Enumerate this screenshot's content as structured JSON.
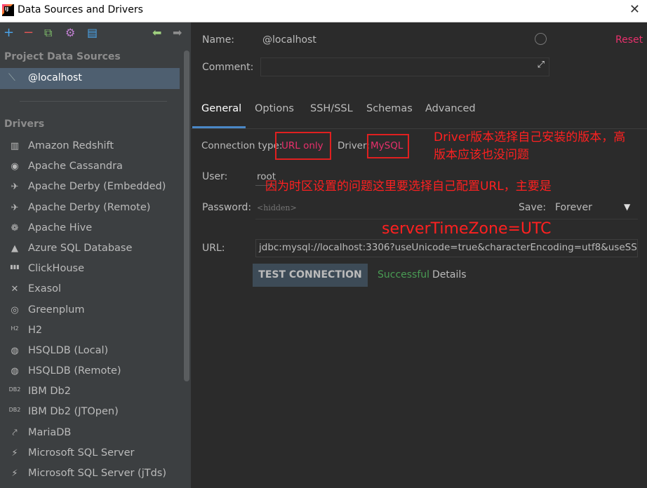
{
  "window": {
    "title": "Data Sources and Drivers"
  },
  "sidebar": {
    "project_label": "Project Data Sources",
    "selected_source": "@localhost",
    "drivers_label": "Drivers",
    "drivers": [
      {
        "label": "Amazon Redshift",
        "icon": "redshift-icon",
        "glyph": "▥"
      },
      {
        "label": "Apache Cassandra",
        "icon": "cassandra-icon",
        "glyph": "◉"
      },
      {
        "label": "Apache Derby (Embedded)",
        "icon": "derby-icon",
        "glyph": "✈"
      },
      {
        "label": "Apache Derby (Remote)",
        "icon": "derby-icon",
        "glyph": "✈"
      },
      {
        "label": "Apache Hive",
        "icon": "hive-icon",
        "glyph": "❁"
      },
      {
        "label": "Azure SQL Database",
        "icon": "azure-icon",
        "glyph": "▲"
      },
      {
        "label": "ClickHouse",
        "icon": "clickhouse-icon",
        "glyph": "▮▮▮"
      },
      {
        "label": "Exasol",
        "icon": "exasol-icon",
        "glyph": "✕"
      },
      {
        "label": "Greenplum",
        "icon": "greenplum-icon",
        "glyph": "◎"
      },
      {
        "label": "H2",
        "icon": "h2-icon",
        "glyph": "H2"
      },
      {
        "label": "HSQLDB (Local)",
        "icon": "hsqldb-icon",
        "glyph": "◍"
      },
      {
        "label": "HSQLDB (Remote)",
        "icon": "hsqldb-icon",
        "glyph": "◍"
      },
      {
        "label": "IBM Db2",
        "icon": "ibm-db2-icon",
        "glyph": "DB2"
      },
      {
        "label": "IBM Db2 (JTOpen)",
        "icon": "ibm-db2-icon",
        "glyph": "DB2"
      },
      {
        "label": "MariaDB",
        "icon": "mariadb-icon",
        "glyph": "⤤"
      },
      {
        "label": "Microsoft SQL Server",
        "icon": "mssql-icon",
        "glyph": "⚡"
      },
      {
        "label": "Microsoft SQL Server (jTds)",
        "icon": "mssql-icon",
        "glyph": "⚡"
      }
    ]
  },
  "form": {
    "name_label": "Name:",
    "name_value": "@localhost",
    "reset_label": "Reset",
    "comment_label": "Comment:",
    "tabs": [
      "General",
      "Options",
      "SSH/SSL",
      "Schemas",
      "Advanced"
    ],
    "connection_type_label": "Connection type:",
    "connection_type_value": "URL only",
    "driver_label": "Driver:",
    "driver_value": "MySQL",
    "user_label": "User:",
    "user_value": "root",
    "password_label": "Password:",
    "password_placeholder": "<hidden>",
    "save_label": "Save:",
    "save_value": "Forever",
    "url_label": "URL:",
    "url_value": "jdbc:mysql://localhost:3306?useUnicode=true&characterEncoding=utf8&useSS",
    "test_button": "TEST CONNECTION",
    "status": "Successful",
    "details_label": "Details"
  },
  "annotations": {
    "driver_note_line1": "Driver版本选择自己安装的版本，高",
    "driver_note_line2": "版本应该也没问题",
    "url_note": "因为时区设置的问题这里要选择自己配置URL，主要是",
    "timezone_note": "serverTimeZone=UTC"
  },
  "colors": {
    "accent": "#4a88c7",
    "reset": "#e8306c",
    "success": "#499c54",
    "annotation": "#ff2020",
    "link_red": "#e8306c"
  }
}
